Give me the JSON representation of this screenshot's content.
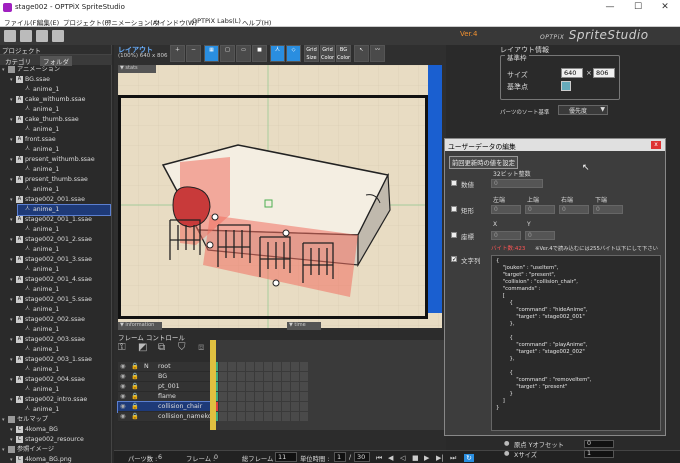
{
  "window": {
    "title": "stage002 - OPTPiX SpriteStudio",
    "minimize": "—",
    "maximize": "☐",
    "close": "✕"
  },
  "menu": [
    "ファイル(F)",
    "編集(E)",
    "プロジェクト(P)",
    "アニメーション(A)",
    "ウインドウ(W)",
    "OPTPiX Labs(L)",
    "ヘルプ(H)"
  ],
  "brand": {
    "version": "Ver.4",
    "name": "SpriteStudio",
    "prefix": "OPTPiX"
  },
  "project": {
    "title": "プロジェクト",
    "tabs": [
      "カテゴリ",
      "フォルダ"
    ],
    "tree": [
      {
        "label": "アニメーション",
        "type": "folder",
        "indent": 0
      },
      {
        "label": "BG.ssae",
        "type": "ssae",
        "indent": 1
      },
      {
        "label": "anime_1",
        "type": "anime",
        "indent": 2
      },
      {
        "label": "cake_withumb.ssae",
        "type": "ssae",
        "indent": 1
      },
      {
        "label": "anime_1",
        "type": "anime",
        "indent": 2
      },
      {
        "label": "cake_thumb.ssae",
        "type": "ssae",
        "indent": 1
      },
      {
        "label": "anime_1",
        "type": "anime",
        "indent": 2
      },
      {
        "label": "front.ssae",
        "type": "ssae",
        "indent": 1
      },
      {
        "label": "anime_1",
        "type": "anime",
        "indent": 2
      },
      {
        "label": "present_withumb.ssae",
        "type": "ssae",
        "indent": 1
      },
      {
        "label": "anime_1",
        "type": "anime",
        "indent": 2
      },
      {
        "label": "present_thumb.ssae",
        "type": "ssae",
        "indent": 1
      },
      {
        "label": "anime_1",
        "type": "anime",
        "indent": 2
      },
      {
        "label": "stage002_001.ssae",
        "type": "ssae",
        "indent": 1
      },
      {
        "label": "anime_1",
        "type": "anime",
        "indent": 2,
        "selected": true
      },
      {
        "label": "stage002_001_1.ssae",
        "type": "ssae",
        "indent": 1
      },
      {
        "label": "anime_1",
        "type": "anime",
        "indent": 2
      },
      {
        "label": "stage002_001_2.ssae",
        "type": "ssae",
        "indent": 1
      },
      {
        "label": "anime_1",
        "type": "anime",
        "indent": 2
      },
      {
        "label": "stage002_001_3.ssae",
        "type": "ssae",
        "indent": 1
      },
      {
        "label": "anime_1",
        "type": "anime",
        "indent": 2
      },
      {
        "label": "stage002_001_4.ssae",
        "type": "ssae",
        "indent": 1
      },
      {
        "label": "anime_1",
        "type": "anime",
        "indent": 2
      },
      {
        "label": "stage002_001_5.ssae",
        "type": "ssae",
        "indent": 1
      },
      {
        "label": "anime_1",
        "type": "anime",
        "indent": 2
      },
      {
        "label": "stage002_002.ssae",
        "type": "ssae",
        "indent": 1
      },
      {
        "label": "anime_1",
        "type": "anime",
        "indent": 2
      },
      {
        "label": "stage002_003.ssae",
        "type": "ssae",
        "indent": 1
      },
      {
        "label": "anime_1",
        "type": "anime",
        "indent": 2
      },
      {
        "label": "stage002_003_1.ssae",
        "type": "ssae",
        "indent": 1
      },
      {
        "label": "anime_1",
        "type": "anime",
        "indent": 2
      },
      {
        "label": "stage002_004.ssae",
        "type": "ssae",
        "indent": 1
      },
      {
        "label": "anime_1",
        "type": "anime",
        "indent": 2
      },
      {
        "label": "stage002_intro.ssae",
        "type": "ssae",
        "indent": 1
      },
      {
        "label": "anime_1",
        "type": "anime",
        "indent": 2
      },
      {
        "label": "セルマップ",
        "type": "folder",
        "indent": 0
      },
      {
        "label": "4koma_BG",
        "type": "cell",
        "indent": 1
      },
      {
        "label": "stage002_resource",
        "type": "cell",
        "indent": 1
      },
      {
        "label": "参照イメージ",
        "type": "folder",
        "indent": 0
      },
      {
        "label": "4koma_BG.png",
        "type": "cell",
        "indent": 1
      }
    ]
  },
  "layout": {
    "title": "レイアウト",
    "subtitle": "(100%) 640 x 806",
    "stats": "▼ stats",
    "information": "▼ information",
    "time": "▼ time",
    "tool_labels": [
      "Grid Size",
      "Grid Color",
      "BG Color"
    ]
  },
  "frame_control": {
    "title": "フレーム コントロール",
    "marker": "10",
    "layers": [
      {
        "name": "root",
        "prefix": "N",
        "indent": 0
      },
      {
        "name": "BG",
        "indent": 1
      },
      {
        "name": "pt_001",
        "indent": 1
      },
      {
        "name": "flame",
        "indent": 1
      },
      {
        "name": "collision_chair",
        "indent": 1,
        "selected": true
      },
      {
        "name": "collision_nameko",
        "indent": 1
      }
    ]
  },
  "status": {
    "parts_label": "パーツ数 :",
    "parts": "6",
    "frame_label": "フレーム :",
    "frame": "0",
    "total_label": "総フレーム :",
    "total": "11",
    "unit_label": "単位時間 :",
    "unit": "1",
    "fps": "30"
  },
  "layout_info": {
    "title": "レイアウト情報",
    "group": "基準枠",
    "size_label": "サイズ",
    "width": "640",
    "times": "×",
    "height": "806",
    "anchor_label": "基準点",
    "sort_label": "パーツのソート基準",
    "sort_value": "優先度"
  },
  "dialog": {
    "title": "ユーザーデータの編集",
    "close": "x",
    "reset_button": "前回更新時の値を設定",
    "int_header": "32ビット整数",
    "numeric_label": "数値",
    "numeric_value": "0",
    "rect_label": "矩形",
    "rect_headers": [
      "左端",
      "上端",
      "右端",
      "下端"
    ],
    "rect_values": [
      "0",
      "0",
      "0",
      "0"
    ],
    "coord_label": "座標",
    "coord_headers": [
      "X",
      "Y"
    ],
    "coord_values": [
      "0",
      "0"
    ],
    "string_label": "文字列",
    "byte_count": "バイト数:423",
    "note": "※Ver.4で読み込むには255バイト以下にして下さい",
    "text": "{\n    \"jouken\" : \"useItem\",\n    \"target\" : \"present\",\n    \"collision\" : \"collision_chair\",\n    \"commands\" :\n    [\n        {\n            \"command\" : \"hideAnime\",\n            \"target\" : \"stage002_001\"\n        },\n\n        {\n            \"command\" : \"playAnime\",\n            \"target\" : \"stage002_002\"\n        },\n\n        {\n            \"command\" : \"removeItem\",\n            \"target\" : \"present\"\n        }\n    ]\n}"
  },
  "props_bottom": [
    {
      "label": "原点 Yオフセット",
      "value": "0"
    },
    {
      "label": "Xサイズ",
      "value": "1"
    }
  ]
}
